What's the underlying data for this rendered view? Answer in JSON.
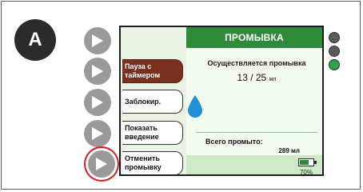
{
  "figure_label": "A",
  "screen": {
    "title": "ПРОМЫВКА",
    "status_message": "Осуществляется промывка",
    "progress_current": "13 / 25",
    "progress_unit": "мл",
    "total_label": "Всего промыто:",
    "total_value": "289 мл",
    "battery_percent": "70%",
    "battery_level": 0.7
  },
  "menu": {
    "items": [
      {
        "label_line1": "Пауза с",
        "label_line2": "таймером",
        "active": true
      },
      {
        "label_line1": "Заблокир.",
        "label_line2": "",
        "active": false
      },
      {
        "label_line1": "Показать",
        "label_line2": "введение",
        "active": false
      },
      {
        "label_line1": "Отменить",
        "label_line2": "промывку",
        "active": false
      }
    ]
  },
  "side_buttons": {
    "icon": "play-triangle-icon",
    "highlighted_index": 4
  },
  "indicators": {
    "colors": [
      "#5a5a5a",
      "#5a5a5a",
      "#2fa24a"
    ]
  },
  "colors": {
    "title_bar": "#2f8a3a",
    "active_menu": "#7a3020",
    "drop": "#1f8fd6",
    "highlight_ring": "#d0202e"
  }
}
